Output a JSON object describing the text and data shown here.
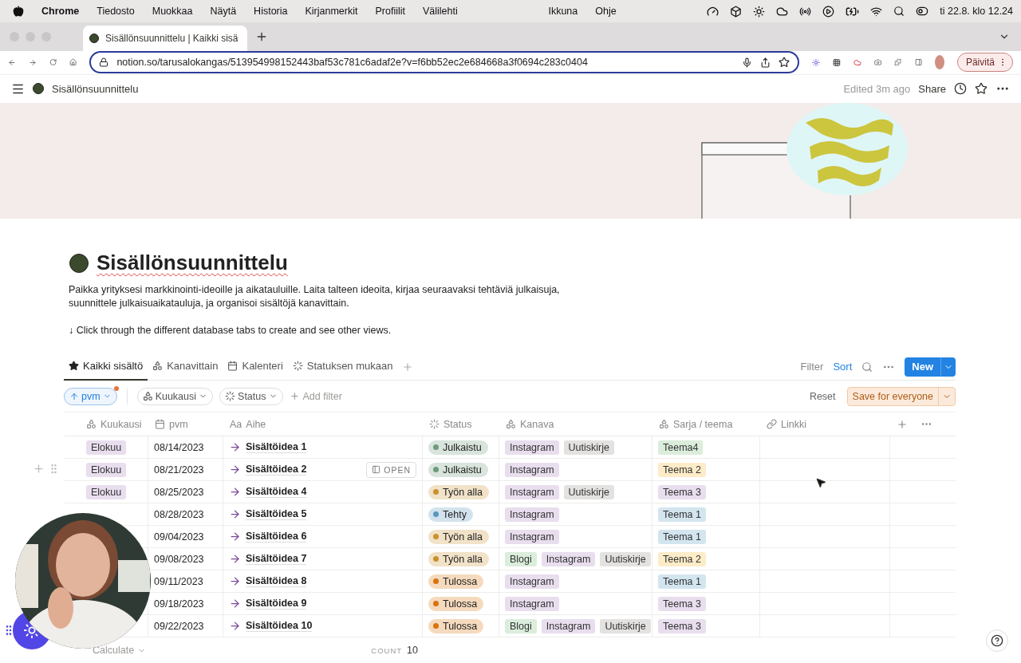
{
  "menu_bar": {
    "app": "Chrome",
    "items": [
      "Tiedosto",
      "Muokkaa",
      "Näytä",
      "Historia",
      "Kirjanmerkit",
      "Profiilit",
      "Välilehti"
    ],
    "right_items": [
      "Ikkuna",
      "Ohje"
    ],
    "clock": "ti 22.8. klo 12.24"
  },
  "browser": {
    "tab_title": "Sisällönsuunnittelu | Kaikki sisä",
    "url": "notion.so/tarusalokangas/513954998152443baf53c781c6adaf2e?v=f6bb52ec2e684668a3f0694c283c0404",
    "update_button": "Päivitä"
  },
  "topbar": {
    "breadcrumb": "Sisällönsuunnittelu",
    "edited": "Edited 3m ago",
    "share": "Share"
  },
  "page": {
    "title": "Sisällönsuunnittelu",
    "description": "Paikka yrityksesi markkinointi-ideoille ja aikatauluille. Laita talteen ideoita, kirjaa seuraavaksi tehtäviä julkaisuja, suunnittele julkaisuaikatauluja, ja organisoi sisältöjä kanavittain.",
    "hint": "↓ Click through the different database tabs to create and see other views."
  },
  "views": [
    {
      "label": "Kaikki sisältö",
      "kind": "star",
      "selected": true
    },
    {
      "label": "Kanavittain",
      "kind": "shapes",
      "selected": false
    },
    {
      "label": "Kalenteri",
      "kind": "calendar",
      "selected": false
    },
    {
      "label": "Statuksen mukaan",
      "kind": "status",
      "selected": false
    }
  ],
  "toolbar": {
    "filter": "Filter",
    "sort": "Sort",
    "new": "New"
  },
  "filters": {
    "sort_chip": "pvm",
    "chips": [
      {
        "label": "Kuukausi",
        "kind": "shapes"
      },
      {
        "label": "Status",
        "kind": "status"
      }
    ],
    "add_filter": "Add filter",
    "reset": "Reset",
    "save": "Save for everyone"
  },
  "table": {
    "columns": [
      {
        "label": "Kuukausi",
        "kind": "shapes"
      },
      {
        "label": "pvm",
        "kind": "calendar"
      },
      {
        "label": "Aihe",
        "kind": "title",
        "icon_text": "Aa"
      },
      {
        "label": "Status",
        "kind": "status"
      },
      {
        "label": "Kanava",
        "kind": "shapes"
      },
      {
        "label": "Sarja / teema",
        "kind": "shapes"
      },
      {
        "label": "Linkki",
        "kind": "link"
      }
    ],
    "rows": [
      {
        "month": {
          "label": "Elokuu",
          "color": "#e8deee"
        },
        "date": "08/14/2023",
        "title": "Sisältöidea 1",
        "hovered": false,
        "status": {
          "label": "Julkaistu",
          "color": "#6c9b7d"
        },
        "channels": [
          {
            "label": "Instagram",
            "color": "#e8deee"
          },
          {
            "label": "Uutiskirje",
            "color": "#e3e2e0"
          }
        ],
        "theme": {
          "label": "Teema4",
          "color": "#dbeddb"
        }
      },
      {
        "month": {
          "label": "Elokuu",
          "color": "#e8deee"
        },
        "date": "08/21/2023",
        "title": "Sisältöidea 2",
        "hovered": true,
        "open_label": "OPEN",
        "status": {
          "label": "Julkaistu",
          "color": "#6c9b7d"
        },
        "channels": [
          {
            "label": "Instagram",
            "color": "#e8deee"
          }
        ],
        "theme": {
          "label": "Teema 2",
          "color": "#fdecc8"
        }
      },
      {
        "month": {
          "label": "Elokuu",
          "color": "#e8deee"
        },
        "date": "08/25/2023",
        "title": "Sisältöidea 4",
        "hovered": false,
        "status": {
          "label": "Työn alla",
          "color": "#cb912f"
        },
        "channels": [
          {
            "label": "Instagram",
            "color": "#e8deee"
          },
          {
            "label": "Uutiskirje",
            "color": "#e3e2e0"
          }
        ],
        "theme": {
          "label": "Teema 3",
          "color": "#e8deee"
        }
      },
      {
        "date": "08/28/2023",
        "title": "Sisältöidea 5",
        "hovered": false,
        "status": {
          "label": "Tehty",
          "color": "#5b97bd"
        },
        "channels": [
          {
            "label": "Instagram",
            "color": "#e8deee"
          }
        ],
        "theme": {
          "label": "Teema 1",
          "color": "#d3e5ef"
        }
      },
      {
        "date": "09/04/2023",
        "title": "Sisältöidea 6",
        "hovered": false,
        "status": {
          "label": "Työn alla",
          "color": "#cb912f"
        },
        "channels": [
          {
            "label": "Instagram",
            "color": "#e8deee"
          }
        ],
        "theme": {
          "label": "Teema 1",
          "color": "#d3e5ef"
        }
      },
      {
        "date": "09/08/2023",
        "title": "Sisältöidea 7",
        "hovered": false,
        "status": {
          "label": "Työn alla",
          "color": "#cb912f"
        },
        "channels": [
          {
            "label": "Blogi",
            "color": "#dbeddb"
          },
          {
            "label": "Instagram",
            "color": "#e8deee"
          },
          {
            "label": "Uutiskirje",
            "color": "#e3e2e0"
          }
        ],
        "theme": {
          "label": "Teema 2",
          "color": "#fdecc8"
        }
      },
      {
        "date": "09/11/2023",
        "title": "Sisältöidea 8",
        "hovered": false,
        "status": {
          "label": "Tulossa",
          "color": "#d9730d"
        },
        "channels": [
          {
            "label": "Instagram",
            "color": "#e8deee"
          }
        ],
        "theme": {
          "label": "Teema 1",
          "color": "#d3e5ef"
        }
      },
      {
        "date": "09/18/2023",
        "title": "Sisältöidea 9",
        "hovered": false,
        "status": {
          "label": "Tulossa",
          "color": "#d9730d"
        },
        "channels": [
          {
            "label": "Instagram",
            "color": "#e8deee"
          }
        ],
        "theme": {
          "label": "Teema 3",
          "color": "#e8deee"
        }
      },
      {
        "date": "09/22/2023",
        "title": "Sisältöidea 10",
        "hovered": false,
        "status": {
          "label": "Tulossa",
          "color": "#d9730d"
        },
        "channels": [
          {
            "label": "Blogi",
            "color": "#dbeddb"
          },
          {
            "label": "Instagram",
            "color": "#e8deee"
          },
          {
            "label": "Uutiskirje",
            "color": "#e3e2e0"
          }
        ],
        "theme": {
          "label": "Teema 3",
          "color": "#e8deee"
        }
      }
    ],
    "footer": {
      "calculate": "Calculate",
      "count_label": "COUNT",
      "count": "10"
    }
  }
}
